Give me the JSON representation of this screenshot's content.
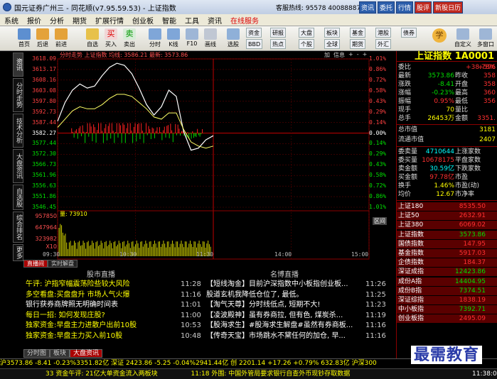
{
  "titlebar": {
    "title": "国元证券广州三 - 同花顺(v7.95.59.53) - 上证指数",
    "hotline": "客服热线: 95578  4008888777",
    "buttons": [
      "资讯",
      "委托",
      "行情",
      "股评",
      "新股日历"
    ]
  },
  "menu": [
    "系统",
    "报价",
    "分析",
    "期货",
    "扩展行情",
    "创业板",
    "智能",
    "工具",
    "资讯",
    "在线服务"
  ],
  "toolbar": {
    "main": [
      {
        "label": "首页",
        "icon": "home-icon"
      },
      {
        "label": "后退",
        "icon": "back-arrow-icon"
      },
      {
        "label": "前进",
        "icon": "forward-arrow-icon"
      },
      {
        "label": "自选",
        "icon": "star-icon"
      },
      {
        "label": "买入",
        "icon": "buy-icon"
      },
      {
        "label": "卖出",
        "icon": "sell-icon"
      },
      {
        "label": "分时",
        "icon": "timeshare-icon"
      },
      {
        "label": "K线",
        "icon": "kline-icon"
      },
      {
        "label": "F10",
        "icon": "f10-icon"
      },
      {
        "label": "画线",
        "icon": "pencil-icon"
      },
      {
        "label": "选股",
        "icon": "filter-icon"
      }
    ],
    "small": [
      "资金",
      "研报",
      "大盘",
      "板块",
      "基金",
      "港股",
      "债券",
      "BBD",
      "热点",
      "个股",
      "全球",
      "期货",
      "外汇"
    ],
    "right": [
      "自定义",
      "多窗口"
    ]
  },
  "left_tabs": [
    "资讯",
    "分时走势",
    "技术分析",
    "大盘资讯",
    "自选股",
    "综合排名",
    "更多"
  ],
  "chart": {
    "header": "分时走势  上证指数  均线: 3586.21  最新: 3573.86",
    "tabs": [
      "加",
      "信息",
      "+",
      "-",
      "+"
    ],
    "y_left": [
      "3618.09",
      "3613.17",
      "3608.16",
      "3603.08",
      "3597.80",
      "3592.73",
      "3587.44",
      "3582.27",
      "3577.44",
      "3572.30",
      "3566.73",
      "3561.96",
      "3556.63",
      "3551.86",
      "3546.45"
    ],
    "y_right": [
      "1.01%",
      "0.86%",
      "0.72%",
      "0.58%",
      "0.43%",
      "0.29%",
      "0.14%",
      "0.00%",
      "0.14%",
      "0.29%",
      "0.43%",
      "0.58%",
      "0.72%",
      "0.86%",
      "1.01%"
    ],
    "x_labels": [
      "09:30",
      "10:30",
      "11:30",
      "14:00",
      "15:00"
    ],
    "volume_label": "量: 73910",
    "volume_ticks": [
      "957850",
      "647964",
      "323982",
      "X10"
    ],
    "volume_tag": "区间",
    "base_value": 3582.27,
    "chart_data": {
      "type": "line",
      "title": "上证指数",
      "series": [
        {
          "name": "最新",
          "values": [
            3588,
            3597,
            3603,
            3606,
            3604,
            3605,
            3610,
            3614,
            3616,
            3615,
            3611,
            3604,
            3596,
            3591,
            3595,
            3603,
            3600,
            3583,
            3574,
            3575,
            3579,
            3581
          ]
        },
        {
          "name": "均线",
          "values": [
            3585,
            3589,
            3593,
            3595,
            3594,
            3594,
            3596,
            3599,
            3601,
            3601,
            3600,
            3597,
            3594,
            3590,
            3589,
            3592,
            3592,
            3584,
            3578,
            3576,
            3575,
            3576
          ]
        }
      ],
      "ylim": [
        3546.45,
        3618.09
      ]
    }
  },
  "news": {
    "tabs": [
      "直播间",
      "实时解盘"
    ],
    "left_header": "股市直播",
    "right_header": "名博直播",
    "left": [
      {
        "text": "午评: 沪指窄幅震荡险些较大风险",
        "time": "11:28"
      },
      {
        "text": "多空看盘:买盘盘升 市场人气火爆",
        "time": "11:16"
      },
      {
        "text": "银行获券商牌照无明确时间表",
        "time": "11:01"
      },
      {
        "text": "每日一招: 如何发现庄股?",
        "time": "11:00"
      },
      {
        "text": "独家资金:早盘主力进散户出前10股",
        "time": "10:53"
      },
      {
        "text": "独家资金:早盘主力买入前10股",
        "time": "10:48"
      }
    ],
    "right": [
      {
        "text": "【短线淘金】目前沪深指数中小板指创业板...",
        "time": "11:26"
      },
      {
        "text": "股道玄机我降低仓位了, 最低。",
        "time": "11:25"
      },
      {
        "text": "【淘气天尊】分时线低点, 短期不大!",
        "time": "11:23"
      },
      {
        "text": "【凌波殿神】虽有券商拉, 但有色, 煤炭杀...",
        "time": "11:19"
      },
      {
        "text": "【股海求生】#股海求生解盘#虽然有券商板...",
        "time": "11:16"
      },
      {
        "text": "【传奇天宝】市场跳水不黛任何的加仓, 早...",
        "time": "11:16"
      }
    ],
    "bottom_tabs": [
      "分时图",
      "板块",
      "大盘资讯"
    ]
  },
  "panel": {
    "index_name": "上证指数 1A0001",
    "rows_top": [
      {
        "k": "委比",
        "v": "+38.78%",
        "k2": "",
        "v2": "+596"
      },
      {
        "k": "最新",
        "v": "3573.86",
        "k2": "昨收",
        "v2": "358"
      },
      {
        "k": "涨跌",
        "v": "-8.41",
        "k2": "开盘",
        "v2": "358"
      },
      {
        "k": "涨幅",
        "v": "-0.23%",
        "k2": "最高",
        "v2": "360"
      },
      {
        "k": "振幅",
        "v": "0.95%",
        "k2": "最低",
        "v2": "356"
      },
      {
        "k": "现手",
        "v": "70",
        "k2": "量比",
        "v2": ""
      },
      {
        "k": "总手",
        "v": "26453万",
        "k2": "金额",
        "v2": "3351."
      }
    ],
    "rows_mid": [
      {
        "k": "总市值",
        "v": "3181"
      },
      {
        "k": "流通市值",
        "v": "2407"
      }
    ],
    "rows_stats": [
      {
        "k": "委卖量",
        "v": "4710644",
        "k2": "上涨家数",
        "v2": ""
      },
      {
        "k": "委买量",
        "v": "10678175",
        "k2": "平盘家数",
        "v2": ""
      },
      {
        "k": "卖金额",
        "v": "30.59亿",
        "k2": "下跌家数",
        "v2": ""
      },
      {
        "k": "买金额",
        "v": "97.78亿",
        "k2": "市盈",
        "v2": ""
      },
      {
        "k": "换手",
        "v": "1.46%",
        "k2": "市盈(动)",
        "v2": ""
      },
      {
        "k": "均价",
        "v": "12.67",
        "k2": "市净率",
        "v2": ""
      }
    ],
    "index_list": [
      {
        "k": "上证180",
        "v": "8535.50",
        "c": "red"
      },
      {
        "k": "上证50",
        "v": "2632.91",
        "c": "red"
      },
      {
        "k": "上证380",
        "v": "6069.02",
        "c": "red"
      },
      {
        "k": "上证指数",
        "v": "3573.86",
        "c": "green"
      },
      {
        "k": "国债指数",
        "v": "147.95",
        "c": "red"
      },
      {
        "k": "基金指数",
        "v": "5917.03",
        "c": "red"
      },
      {
        "k": "企债指数",
        "v": "184.37",
        "c": "red"
      },
      {
        "k": "深证成指",
        "v": "12423.86",
        "c": "green"
      },
      {
        "k": "成份A指",
        "v": "14404.95",
        "c": "green"
      },
      {
        "k": "成份B指",
        "v": "7374.51",
        "c": "green"
      },
      {
        "k": "深证综指",
        "v": "1838.19",
        "c": "red"
      },
      {
        "k": "中小板指",
        "v": "7392.71",
        "c": "green"
      },
      {
        "k": "创业板指",
        "v": "2495.09",
        "c": "red"
      }
    ]
  },
  "status": {
    "line1": "沪3573.86  -8.41 -0.23%3351.82亿  深证 2423.86  -5.25 -0.04%2941.44亿  创  2201.14 +17.26 +0.79%  632.83亿  沪深300",
    "line2_a": "33 资金午评: 21亿大单资金流入两板块",
    "line2_b": "11:18 外围: 中国外管局要求银行自查外币现钞存取数据",
    "clock": "11:38:0"
  },
  "watermark": "最需教育"
}
